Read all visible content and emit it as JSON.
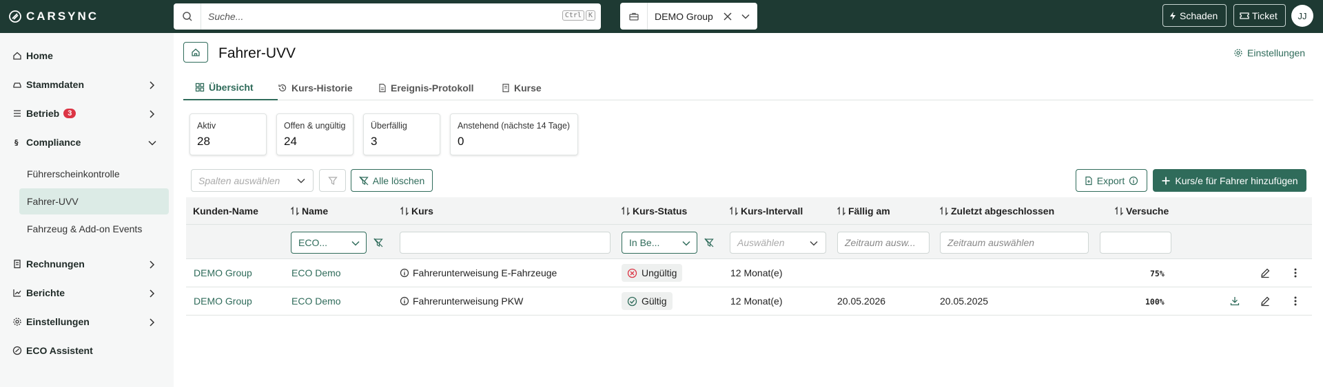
{
  "topbar": {
    "logo_text": "CARSYNC",
    "search_placeholder": "Suche...",
    "kbd": [
      "Ctrl",
      "K"
    ],
    "group": "DEMO Group",
    "schaden_label": "Schaden",
    "ticket_label": "Ticket",
    "avatar_initials": "JJ"
  },
  "sidebar": {
    "items": [
      {
        "label": "Home"
      },
      {
        "label": "Stammdaten"
      },
      {
        "label": "Betrieb",
        "badge": "3"
      },
      {
        "label": "Compliance"
      },
      {
        "label": "Rechnungen"
      },
      {
        "label": "Berichte"
      },
      {
        "label": "Einstellungen"
      },
      {
        "label": "ECO Assistent"
      }
    ],
    "compliance_sub": [
      "Führerscheinkontrolle",
      "Fahrer-UVV",
      "Fahrzeug & Add-on Events"
    ]
  },
  "page": {
    "title": "Fahrer-UVV",
    "settings_label": "Einstellungen",
    "tabs": [
      "Übersicht",
      "Kurs-Historie",
      "Ereignis-Protokoll",
      "Kurse"
    ]
  },
  "cards": [
    {
      "label": "Aktiv",
      "value": "28"
    },
    {
      "label": "Offen & ungültig",
      "value": "24"
    },
    {
      "label": "Überfällig",
      "value": "3"
    },
    {
      "label": "Anstehend (nächste 14 Tage)",
      "value": "0"
    }
  ],
  "toolbar": {
    "columns_placeholder": "Spalten auswählen",
    "clear_label": "Alle löschen",
    "export_label": "Export",
    "add_label": "Kurs/e für Fahrer hinzufügen"
  },
  "table": {
    "headers": [
      "Kunden-Name",
      "Name",
      "Kurs",
      "Kurs-Status",
      "Kurs-Intervall",
      "Fällig am",
      "Zuletzt abgeschlossen",
      "Versuche"
    ],
    "filters": {
      "name": "ECO...",
      "status": "In Be...",
      "intervall_placeholder": "Auswählen",
      "faellig_placeholder": "Zeitraum ausw...",
      "zuletzt_placeholder": "Zeitraum auswählen"
    },
    "rows": [
      {
        "kunde": "DEMO Group",
        "name": "ECO Demo",
        "kurs": "Fahrerunterweisung E-Fahrzeuge",
        "status": "Ungültig",
        "intervall": "12 Monat(e)",
        "faellig": "",
        "zuletzt": "",
        "versuche": "75%"
      },
      {
        "kunde": "DEMO Group",
        "name": "ECO Demo",
        "kurs": "Fahrerunterweisung PKW",
        "status": "Gültig",
        "intervall": "12 Monat(e)",
        "faellig": "20.05.2026",
        "zuletzt": "20.05.2025",
        "versuche": "100%"
      }
    ]
  },
  "colors": {
    "topbar": "#1e3a33",
    "accent": "#2f6b5a",
    "badge": "#dc3545",
    "invalid": "#dc3545"
  }
}
